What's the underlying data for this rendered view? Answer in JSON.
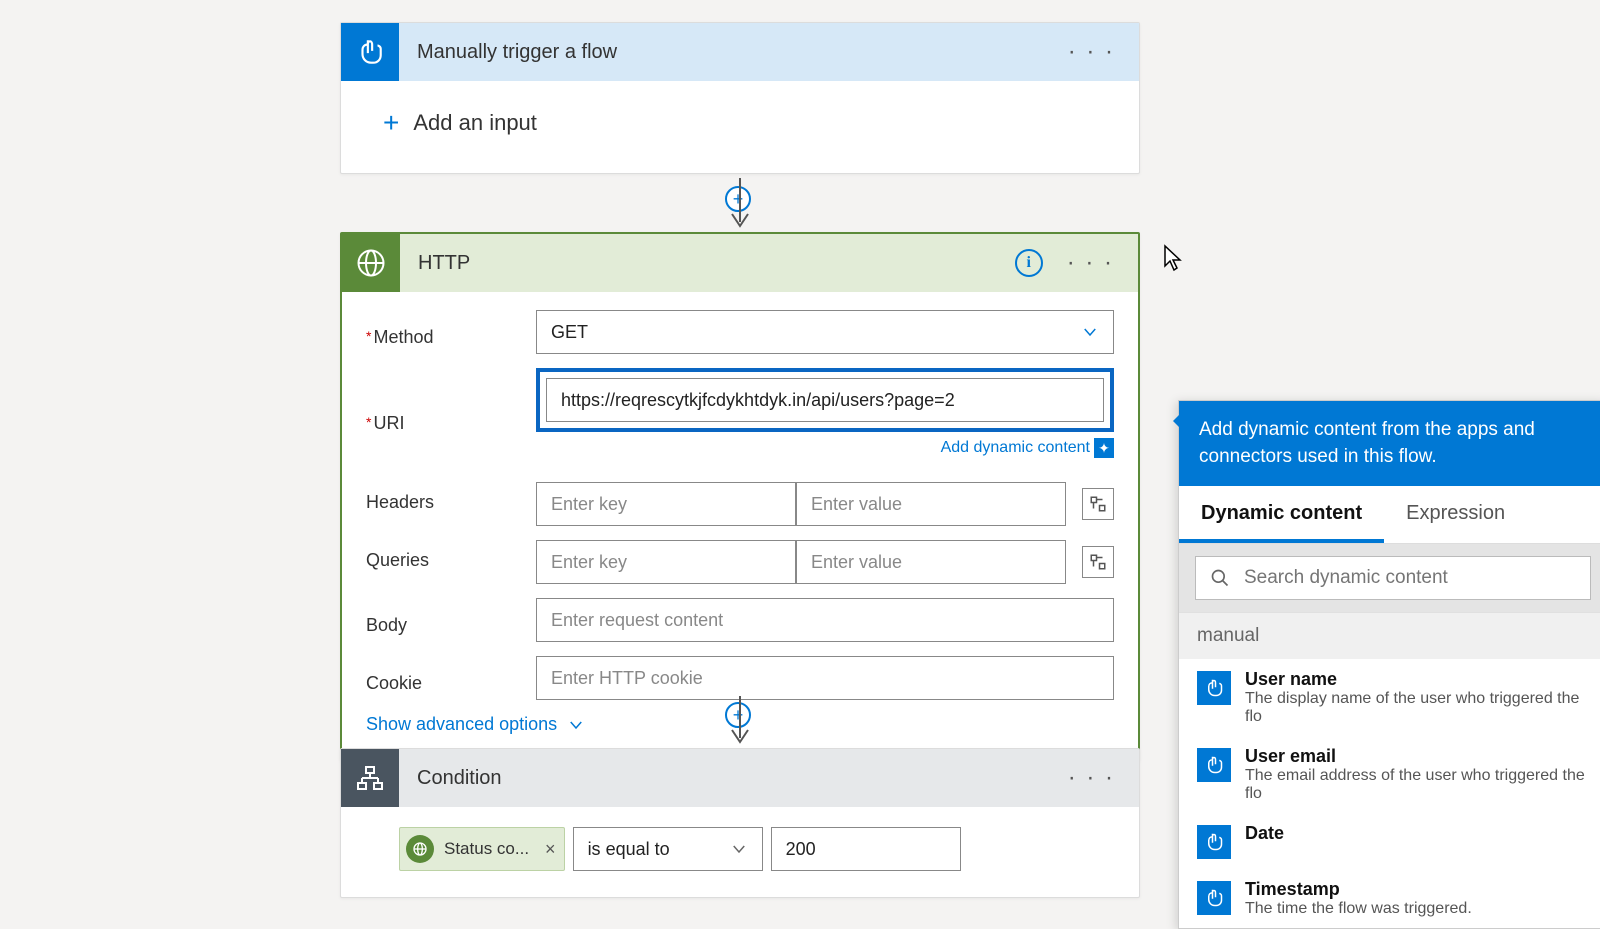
{
  "trigger": {
    "title": "Manually trigger a flow",
    "add_input": "Add an input"
  },
  "http": {
    "title": "HTTP",
    "method_label": "Method",
    "method_value": "GET",
    "uri_label": "URI",
    "uri_value": "https://reqrescytkjfcdykhtdyk.in/api/users?page=2",
    "dyn_link": "Add dynamic content",
    "headers_label": "Headers",
    "queries_label": "Queries",
    "body_label": "Body",
    "cookie_label": "Cookie",
    "key_ph": "Enter key",
    "val_ph": "Enter value",
    "body_ph": "Enter request content",
    "cookie_ph": "Enter HTTP cookie",
    "adv": "Show advanced options"
  },
  "condition": {
    "title": "Condition",
    "pill": "Status co...",
    "op": "is equal to",
    "val": "200"
  },
  "dyn": {
    "header": "Add dynamic content from the apps and connectors used in this flow.",
    "tab1": "Dynamic content",
    "tab2": "Expression",
    "search_ph": "Search dynamic content",
    "section": "manual",
    "items": [
      {
        "title": "User name",
        "desc": "The display name of the user who triggered the flo"
      },
      {
        "title": "User email",
        "desc": "The email address of the user who triggered the flo"
      },
      {
        "title": "Date",
        "desc": ""
      },
      {
        "title": "Timestamp",
        "desc": "The time the flow was triggered."
      }
    ]
  }
}
